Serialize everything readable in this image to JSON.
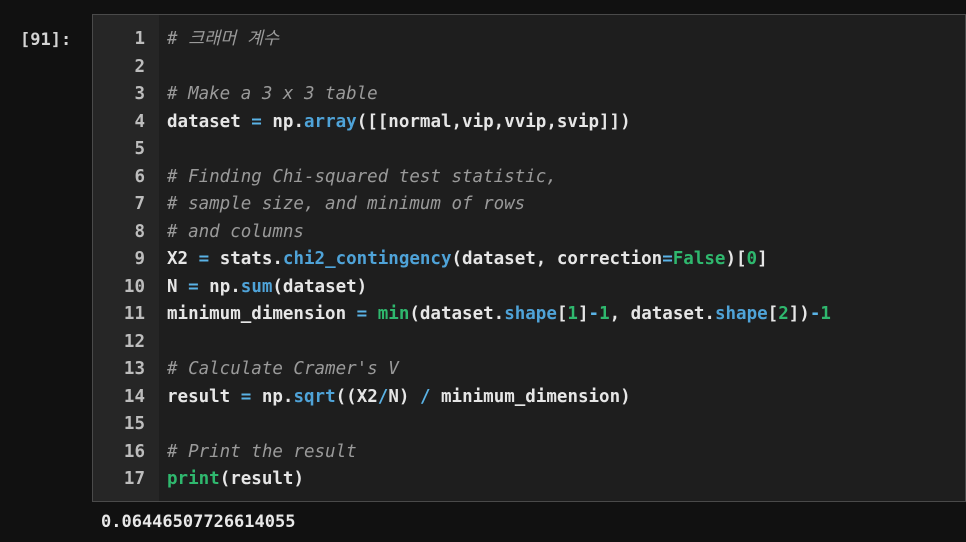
{
  "cell": {
    "prompt": "[91]:",
    "lines": [
      {
        "num": "1",
        "code": "# 크래머 계수"
      },
      {
        "num": "2",
        "code": ""
      },
      {
        "num": "3",
        "code": "# Make a 3 x 3 table"
      },
      {
        "num": "4",
        "code": "dataset = np.array([[normal,vip,vvip,svip]])"
      },
      {
        "num": "5",
        "code": ""
      },
      {
        "num": "6",
        "code": "# Finding Chi-squared test statistic,"
      },
      {
        "num": "7",
        "code": "# sample size, and minimum of rows"
      },
      {
        "num": "8",
        "code": "# and columns"
      },
      {
        "num": "9",
        "code": "X2 = stats.chi2_contingency(dataset, correction=False)[0]"
      },
      {
        "num": "10",
        "code": "N = np.sum(dataset)"
      },
      {
        "num": "11",
        "code": "minimum_dimension = min(dataset.shape[1]-1, dataset.shape[2])-1"
      },
      {
        "num": "12",
        "code": ""
      },
      {
        "num": "13",
        "code": "# Calculate Cramer's V"
      },
      {
        "num": "14",
        "code": "result = np.sqrt((X2/N) / minimum_dimension)"
      },
      {
        "num": "15",
        "code": ""
      },
      {
        "num": "16",
        "code": "# Print the result"
      },
      {
        "num": "17",
        "code": "print(result)"
      }
    ]
  },
  "output": {
    "text": "0.06446507726614055"
  },
  "colors": {
    "background": "#111111",
    "cell_background": "#1e1e1e",
    "comment": "#9a9a9a",
    "function": "#4fa3d8",
    "keyword": "#2fb86e",
    "text": "#e6e6e6"
  }
}
